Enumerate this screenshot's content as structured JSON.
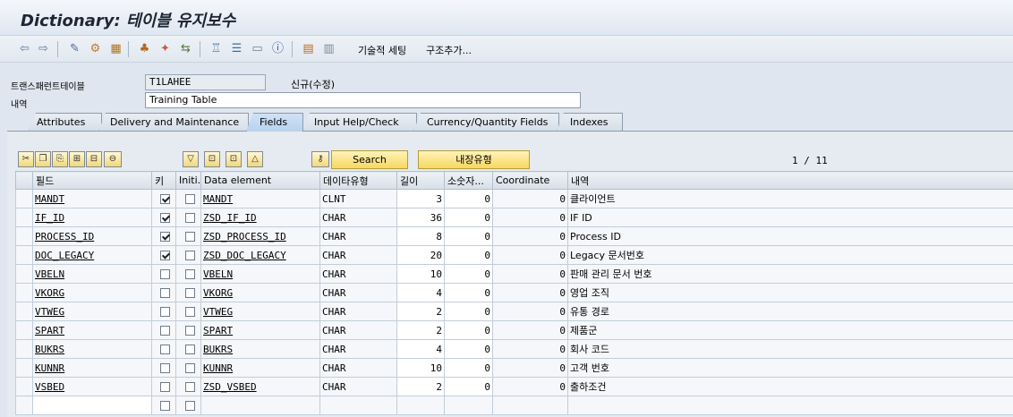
{
  "window": {
    "title": "Dictionary: 테이블 유지보수"
  },
  "toolbar": {
    "tech_settings": "기술적 세팅",
    "append_structure": "구조추가..."
  },
  "header": {
    "table_label": "트랜스패런트테이블",
    "table_name": "T1LAHEE",
    "status": "신규(수정)",
    "desc_label": "내역",
    "desc_value": "Training Table"
  },
  "tabs": [
    {
      "label": "Attributes"
    },
    {
      "label": "Delivery and Maintenance"
    },
    {
      "label": "Fields"
    },
    {
      "label": "Input Help/Check"
    },
    {
      "label": "Currency/Quantity Fields"
    },
    {
      "label": "Indexes"
    }
  ],
  "active_tab": "Fields",
  "buttons": {
    "search": "Search",
    "builtin_type": "내장유형"
  },
  "pager": "1 / 11",
  "columns": [
    "필드",
    "키",
    "Initi...",
    "Data element",
    "데이타유형",
    "길이",
    "소숫자...",
    "Coordinate",
    "내역"
  ],
  "rows": [
    {
      "field": "MANDT",
      "key": true,
      "init": false,
      "element": "MANDT",
      "type": "CLNT",
      "len": "3",
      "dec": "0",
      "coord": "0",
      "desc": "클라이언트"
    },
    {
      "field": "IF_ID",
      "key": true,
      "init": false,
      "element": "ZSD_IF_ID",
      "type": "CHAR",
      "len": "36",
      "dec": "0",
      "coord": "0",
      "desc": "IF ID"
    },
    {
      "field": "PROCESS_ID",
      "key": true,
      "init": false,
      "element": "ZSD_PROCESS_ID",
      "type": "CHAR",
      "len": "8",
      "dec": "0",
      "coord": "0",
      "desc": "Process ID"
    },
    {
      "field": "DOC_LEGACY",
      "key": true,
      "init": false,
      "element": "ZSD_DOC_LEGACY",
      "type": "CHAR",
      "len": "20",
      "dec": "0",
      "coord": "0",
      "desc": "Legacy 문서번호"
    },
    {
      "field": "VBELN",
      "key": false,
      "init": false,
      "element": "VBELN",
      "type": "CHAR",
      "len": "10",
      "dec": "0",
      "coord": "0",
      "desc": "판매 관리 문서 번호"
    },
    {
      "field": "VKORG",
      "key": false,
      "init": false,
      "element": "VKORG",
      "type": "CHAR",
      "len": "4",
      "dec": "0",
      "coord": "0",
      "desc": "영업 조직"
    },
    {
      "field": "VTWEG",
      "key": false,
      "init": false,
      "element": "VTWEG",
      "type": "CHAR",
      "len": "2",
      "dec": "0",
      "coord": "0",
      "desc": "유통 경로"
    },
    {
      "field": "SPART",
      "key": false,
      "init": false,
      "element": "SPART",
      "type": "CHAR",
      "len": "2",
      "dec": "0",
      "coord": "0",
      "desc": "제품군"
    },
    {
      "field": "BUKRS",
      "key": false,
      "init": false,
      "element": "BUKRS",
      "type": "CHAR",
      "len": "4",
      "dec": "0",
      "coord": "0",
      "desc": "회사 코드"
    },
    {
      "field": "KUNNR",
      "key": false,
      "init": false,
      "element": "KUNNR",
      "type": "CHAR",
      "len": "10",
      "dec": "0",
      "coord": "0",
      "desc": "고객 번호"
    },
    {
      "field": "VSBED",
      "key": false,
      "init": false,
      "element": "ZSD_VSBED",
      "type": "CHAR",
      "len": "2",
      "dec": "0",
      "coord": "0",
      "desc": "출하조건"
    }
  ]
}
